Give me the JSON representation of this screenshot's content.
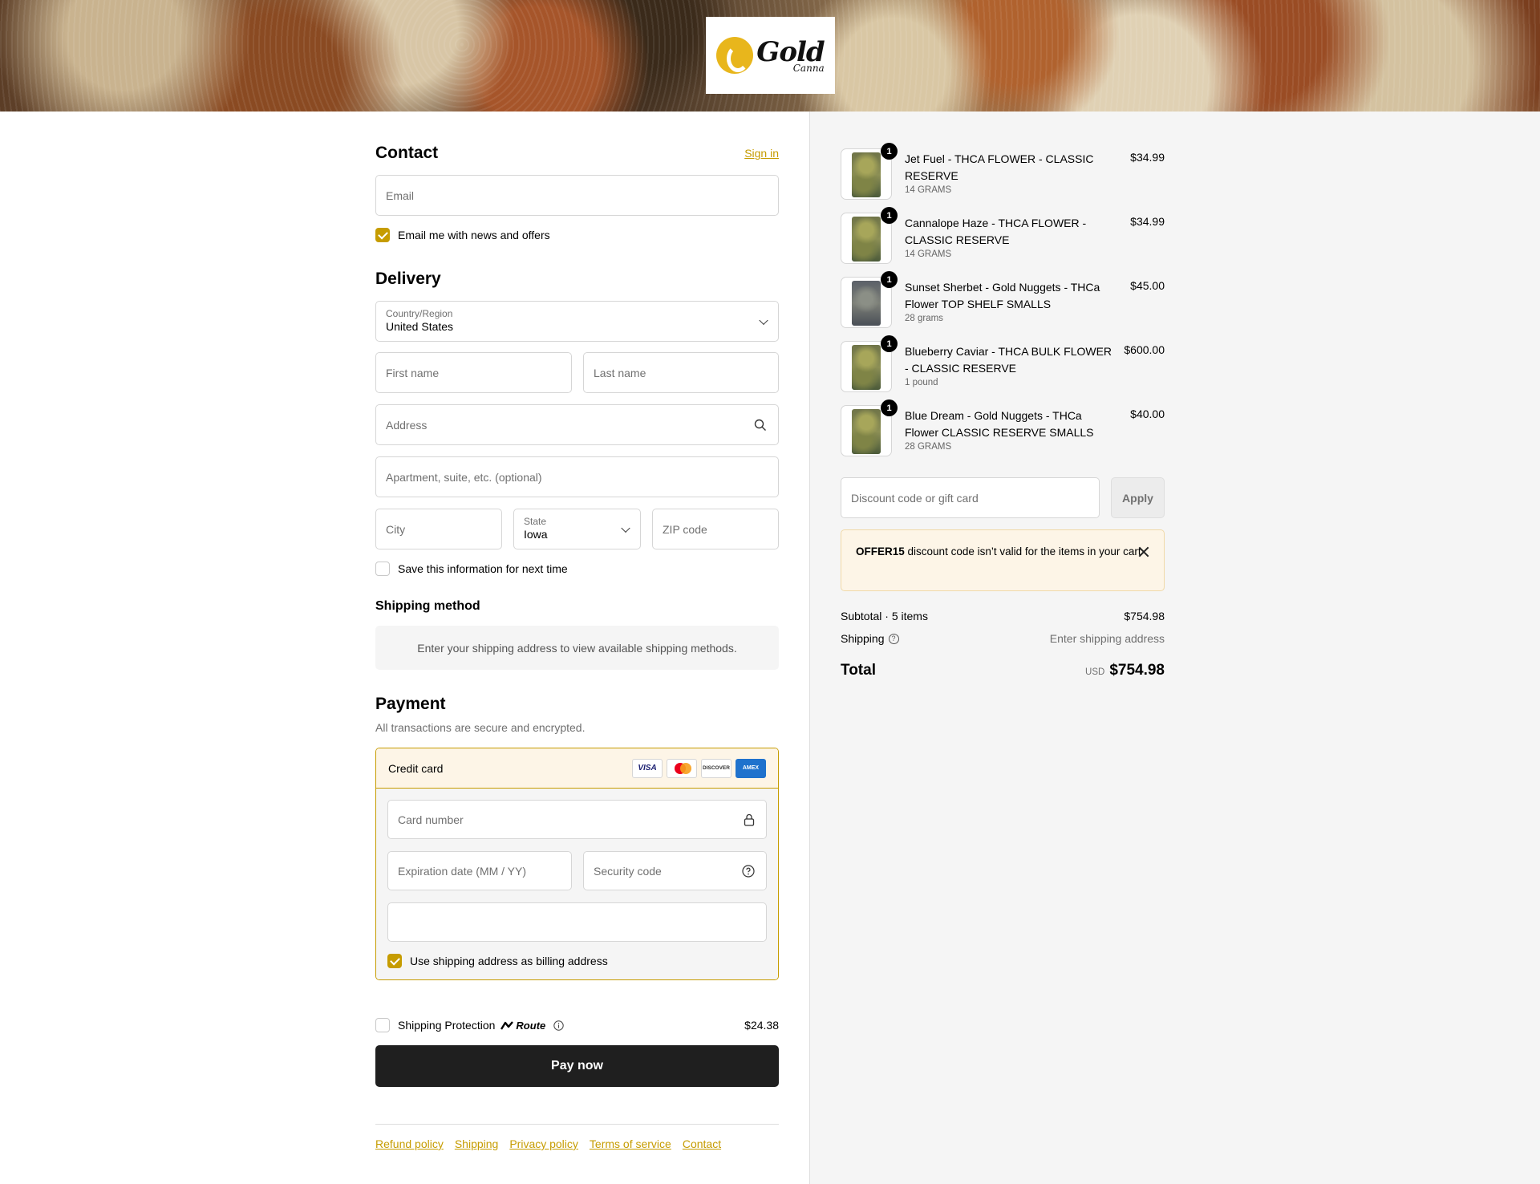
{
  "header": {
    "logo_word": "Gold",
    "logo_sub": "Canna"
  },
  "contact": {
    "title": "Contact",
    "sign_in": "Sign in",
    "email_placeholder": "Email",
    "news_label": "Email me with news and offers",
    "news_checked": true
  },
  "delivery": {
    "title": "Delivery",
    "country_label": "Country/Region",
    "country_value": "United States",
    "first_name_placeholder": "First name",
    "last_name_placeholder": "Last name",
    "address_placeholder": "Address",
    "apartment_placeholder": "Apartment, suite, etc. (optional)",
    "city_placeholder": "City",
    "state_label": "State",
    "state_value": "Iowa",
    "zip_placeholder": "ZIP code",
    "save_label": "Save this information for next time",
    "save_checked": false
  },
  "shipping_method": {
    "title": "Shipping method",
    "message": "Enter your shipping address to view available shipping methods."
  },
  "payment": {
    "title": "Payment",
    "subtitle": "All transactions are secure and encrypted.",
    "method_label": "Credit card",
    "brands": [
      "VISA",
      "Mastercard",
      "DISCOVER",
      "AMEX"
    ],
    "card_number_placeholder": "Card number",
    "expiration_placeholder": "Expiration date (MM / YY)",
    "security_placeholder": "Security code",
    "billing_label": "Use shipping address as billing address",
    "billing_checked": true
  },
  "protection": {
    "label": "Shipping Protection",
    "brand": "Route",
    "price": "$24.38",
    "checked": false
  },
  "pay_button": "Pay now",
  "footer_links": [
    "Refund policy",
    "Shipping",
    "Privacy policy",
    "Terms of service",
    "Contact"
  ],
  "cart": {
    "items": [
      {
        "qty": "1",
        "name": "Jet Fuel - THCA FLOWER - CLASSIC RESERVE",
        "variant": "14 GRAMS",
        "price": "$34.99"
      },
      {
        "qty": "1",
        "name": "Cannalope Haze - THCA FLOWER - CLASSIC RESERVE",
        "variant": "14 GRAMS",
        "price": "$34.99"
      },
      {
        "qty": "1",
        "name": "Sunset Sherbet - Gold Nuggets - THCa Flower TOP SHELF SMALLS",
        "variant": "28 grams",
        "price": "$45.00"
      },
      {
        "qty": "1",
        "name": "Blueberry Caviar - THCA BULK FLOWER - CLASSIC RESERVE",
        "variant": "1 pound",
        "price": "$600.00"
      },
      {
        "qty": "1",
        "name": "Blue Dream - Gold Nuggets - THCa Flower CLASSIC RESERVE SMALLS",
        "variant": "28 GRAMS",
        "price": "$40.00"
      }
    ],
    "discount_placeholder": "Discount code or gift card",
    "apply_label": "Apply",
    "alert_code": "OFFER15",
    "alert_text": "discount code isn’t valid for the items in your cart",
    "subtotal_label": "Subtotal · 5 items",
    "subtotal_value": "$754.98",
    "shipping_label": "Shipping",
    "shipping_value": "Enter shipping address",
    "total_label": "Total",
    "currency": "USD",
    "total_value": "$754.98"
  },
  "colors": {
    "accent": "#c69c00",
    "button": "#1f1f1f",
    "sidebar_bg": "#f5f5f5",
    "alert_bg": "#fdf5e7"
  }
}
